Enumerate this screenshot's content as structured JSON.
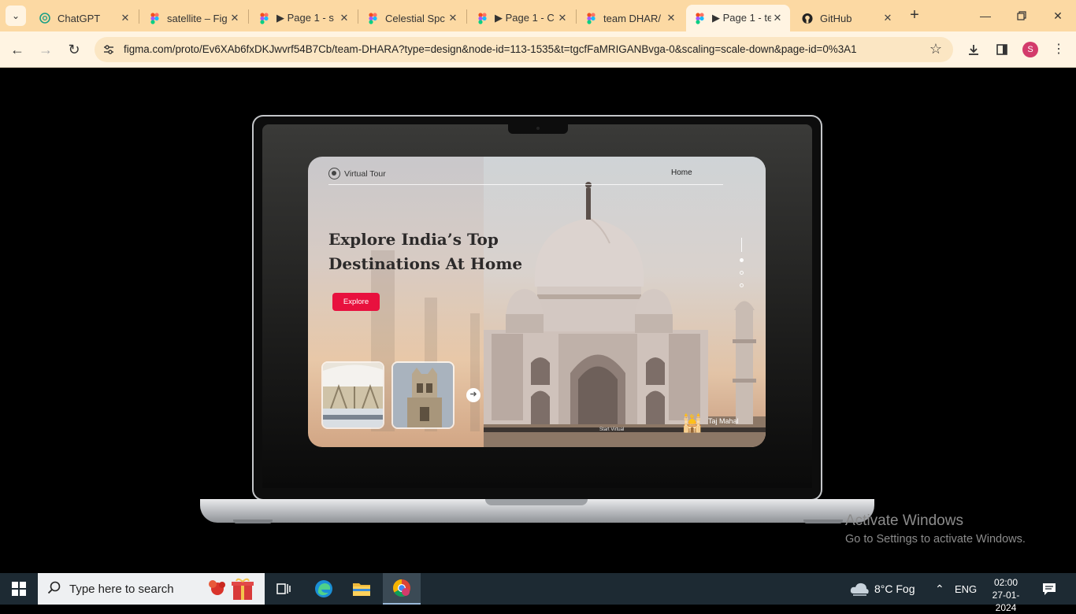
{
  "browser": {
    "tabs": [
      {
        "label": "ChatGPT",
        "icon": "chatgpt-icon",
        "active": false
      },
      {
        "label": "satellite – Fig",
        "icon": "figma-icon",
        "active": false
      },
      {
        "label": "▶ Page 1 - s",
        "icon": "figma-icon",
        "active": false
      },
      {
        "label": "Celestial Spc",
        "icon": "figma-icon",
        "active": false
      },
      {
        "label": "▶ Page 1 - C",
        "icon": "figma-icon",
        "active": false
      },
      {
        "label": "team DHAR/",
        "icon": "figma-icon",
        "active": false
      },
      {
        "label": "▶ Page 1 - te",
        "icon": "figma-icon",
        "active": true
      },
      {
        "label": "GitHub",
        "icon": "github-icon",
        "active": false
      }
    ],
    "url": "figma.com/proto/Ev6XAb6fxDKJwvrf54B7Cb/team-DHARA?type=design&node-id=113-1535&t=tgcfFaMRIGANBvga-0&scaling=scale-down&page-id=0%3A1",
    "profile_initial": "S",
    "accent": "#fcd9a3"
  },
  "prototype": {
    "brand": "Virtual Tour",
    "nav_home": "Home",
    "headline": "Explore India’s Top Destinations At Home",
    "cta": "Explore",
    "place": "Taj Mahal",
    "caption": "Start Virtual",
    "cta_color": "#e8113e",
    "carousel_dots": 3,
    "active_dot": 1
  },
  "watermark": {
    "title": "Activate Windows",
    "subtitle": "Go to Settings to activate Windows."
  },
  "taskbar": {
    "search_placeholder": "Type here to search",
    "weather": "8°C  Fog",
    "language": "ENG",
    "time": "02:00",
    "date": "27-01-2024"
  }
}
